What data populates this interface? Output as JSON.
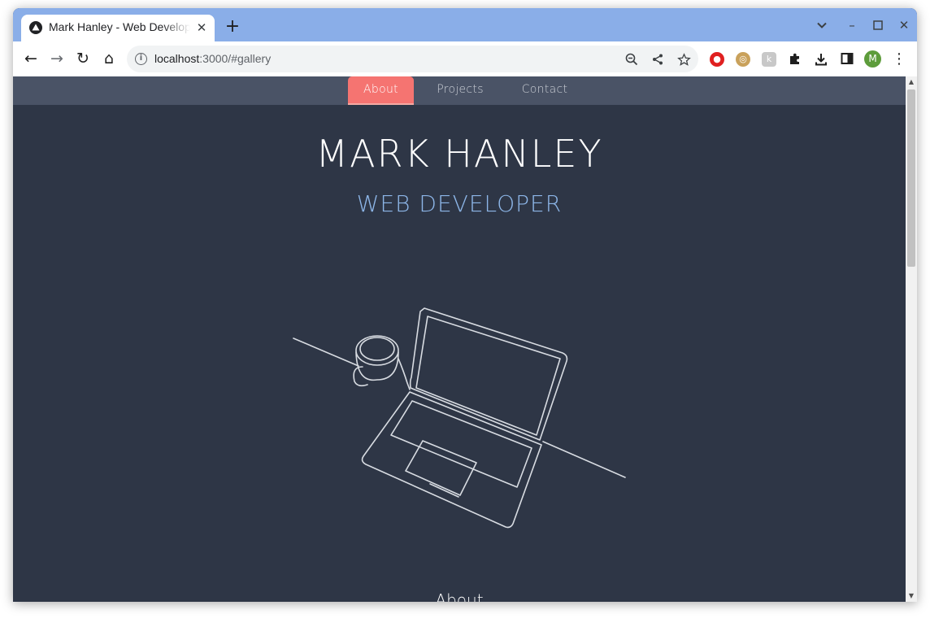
{
  "browser": {
    "tab": {
      "title": "Mark Hanley - Web Developer",
      "favicon": "app-triangle-icon",
      "close_glyph": "✕"
    },
    "new_tab_glyph": "+",
    "window_controls": {
      "menu": "⌄",
      "minimize": "–",
      "maximize": "☐",
      "close": "✕"
    },
    "nav": {
      "back": "←",
      "forward": "→",
      "reload": "↻",
      "home": "⌂"
    },
    "url": {
      "host": "localhost",
      "path": ":3000/#gallery"
    },
    "omnibox_icons": {
      "zoom": "search-minus-icon",
      "share": "share-icon",
      "bookmark": "star-icon"
    },
    "extensions": [
      "red-extension-icon",
      "bronze-extension-icon",
      "grey-extension-icon",
      "puzzle-icon"
    ],
    "download_glyph": "⭳",
    "profile_initial": "M",
    "menu_glyph": "⋮",
    "colors": {
      "tabbar": "#8aaee8",
      "profile": "#5d9c3b"
    }
  },
  "site": {
    "nav": {
      "items": [
        "About",
        "Projects",
        "Contact"
      ],
      "active": "About"
    },
    "hero": {
      "name": "MARK HANLEY",
      "role": "WEB DEVELOPER"
    },
    "illustration": "laptop-and-mug-line-art",
    "section_title": "About",
    "colors": {
      "background": "#2e3646",
      "nav": "#4a5366",
      "accent": "#f57471",
      "role": "#8db6e8"
    }
  }
}
